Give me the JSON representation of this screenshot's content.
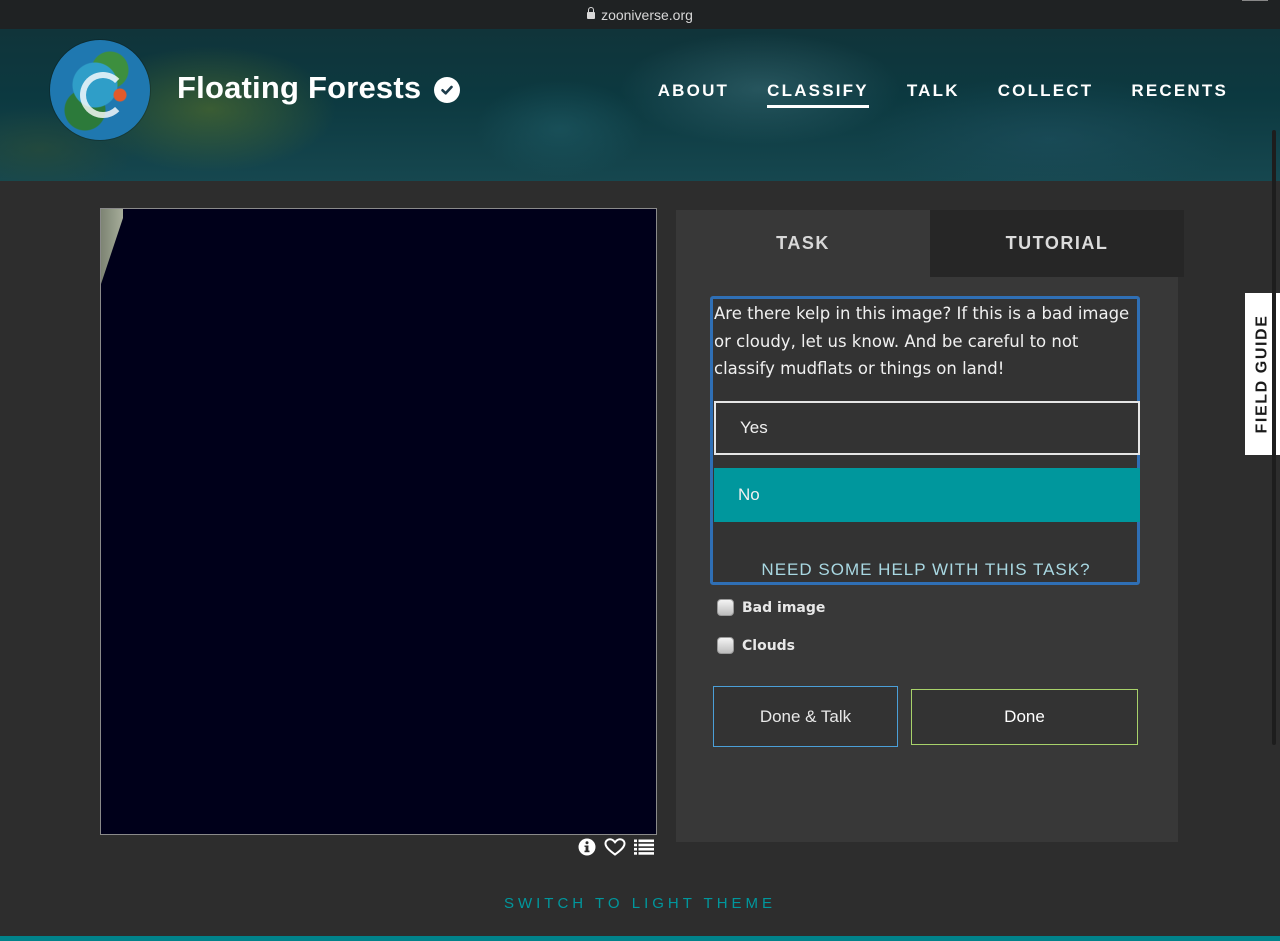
{
  "browser": {
    "url": "zooniverse.org"
  },
  "project": {
    "title": "Floating Forests"
  },
  "nav": {
    "items": [
      {
        "label": "ABOUT",
        "active": false
      },
      {
        "label": "CLASSIFY",
        "active": true
      },
      {
        "label": "TALK",
        "active": false
      },
      {
        "label": "COLLECT",
        "active": false
      },
      {
        "label": "RECENTS",
        "active": false
      }
    ]
  },
  "tabs": {
    "task": "TASK",
    "tutorial": "TUTORIAL"
  },
  "task": {
    "question": "Are there kelp in this image? If this is a bad image or cloudy, let us know. And be careful to not classify mudflats or things on land!",
    "answers": [
      "Yes",
      "No"
    ],
    "help_link": "NEED SOME HELP WITH THIS TASK?"
  },
  "checkboxes": {
    "bad_image": "Bad image",
    "clouds": "Clouds"
  },
  "buttons": {
    "done_talk": "Done & Talk",
    "done": "Done"
  },
  "field_guide": "FIELD GUIDE",
  "footer": {
    "theme_link": "SWITCH TO LIGHT THEME"
  },
  "icons": [
    "lock-icon",
    "verified-icon",
    "info-icon",
    "heart-icon",
    "list-icon"
  ],
  "colors": {
    "accent": "#00979d",
    "task_border": "#2f6fb5",
    "done_border": "#a8d26a",
    "done_talk_border": "#4b9fd8"
  }
}
